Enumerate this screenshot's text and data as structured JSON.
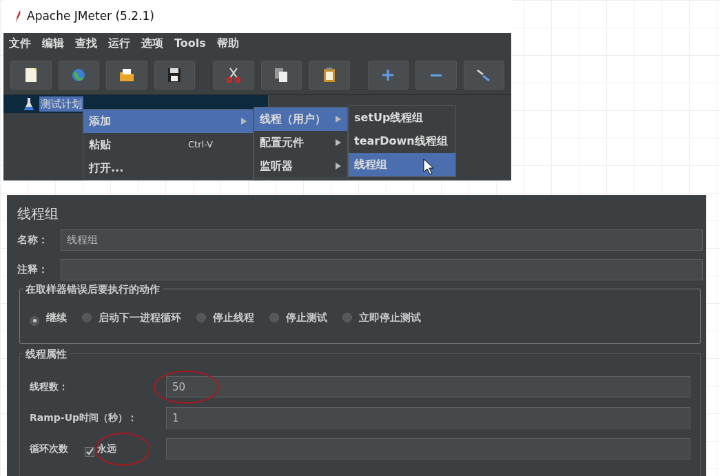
{
  "window": {
    "title": "Apache JMeter (5.2.1)"
  },
  "menu": [
    "文件",
    "编辑",
    "查找",
    "运行",
    "选项",
    "Tools",
    "帮助"
  ],
  "toolbar": [
    {
      "kind": "new",
      "separator_before": false
    },
    {
      "kind": "templates",
      "separator_before": false
    },
    {
      "kind": "open",
      "separator_before": false
    },
    {
      "kind": "save",
      "separator_before": false
    },
    {
      "kind": "cut",
      "separator_before": true
    },
    {
      "kind": "copy",
      "separator_before": false
    },
    {
      "kind": "paste",
      "separator_before": false
    },
    {
      "kind": "expand",
      "separator_before": true
    },
    {
      "kind": "collapse",
      "separator_before": false
    },
    {
      "kind": "toggle",
      "separator_before": false
    }
  ],
  "tree": [
    {
      "label": "测试计划",
      "selected": true
    }
  ],
  "context_menu": [
    {
      "label": "添加",
      "submenu": true,
      "selected": true
    },
    {
      "label": "粘贴",
      "shortcut": "Ctrl-V",
      "submenu": false,
      "selected": false
    },
    {
      "label": "打开...",
      "submenu": false,
      "selected": false
    }
  ],
  "submenu": [
    {
      "label": "线程（用户）",
      "submenu": true,
      "selected": true
    },
    {
      "label": "配置元件",
      "submenu": true,
      "selected": false
    },
    {
      "label": "监听器",
      "submenu": true,
      "selected": false
    }
  ],
  "thread_menu": [
    {
      "label": "setUp线程组",
      "selected": false
    },
    {
      "label": "tearDown线程组",
      "selected": false
    },
    {
      "label": "线程组",
      "selected": true
    }
  ],
  "panel": {
    "title": "线程组",
    "fields": [
      {
        "label": "名称：",
        "value": "线程组"
      },
      {
        "label": "注释："
      }
    ],
    "on_error": {
      "title": "在取样器错误后要执行的动作",
      "options": [
        {
          "label": "继续",
          "selected": true
        },
        {
          "label": "启动下一进程循环",
          "selected": false
        },
        {
          "label": "停止线程",
          "selected": false
        },
        {
          "label": "停止测试",
          "selected": false
        },
        {
          "label": "立即停止测试",
          "selected": false
        }
      ]
    },
    "thread_properties": {
      "title": "线程属性",
      "threads": {
        "label": "线程数：",
        "value": "50",
        "annotated": true
      },
      "ramp_up": {
        "label": "Ramp-Up时间（秒）：",
        "value": "1"
      },
      "loop": {
        "label": "循环次数",
        "forever_label": "永远",
        "checked": true,
        "annotated": true
      }
    }
  }
}
